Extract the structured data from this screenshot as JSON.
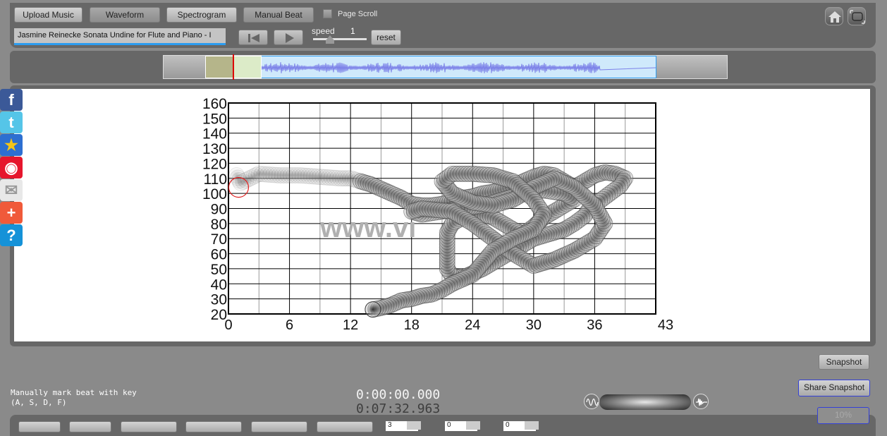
{
  "toolbar": {
    "buttons": [
      "Upload Music",
      "Waveform",
      "Spectrogram",
      "Manual Beat"
    ],
    "page_scroll_label": "Page Scroll",
    "page_scroll_checked": false,
    "track_title": "Jasmine Reinecke Sonata Undine for Flute and Piano - I",
    "speed_label": "speed",
    "speed_value": "1",
    "speed_fraction": 0.33,
    "reset_label": "reset",
    "rewind_icon": "skip-to-start-icon",
    "play_icon": "play-icon",
    "home_icon": "home-icon",
    "fullscreen_icon": "fullscreen-icon"
  },
  "overview": {
    "visible_window_start_fraction": 0.0,
    "visible_window_end_fraction": 1.0,
    "playhead_fraction": 0.0,
    "waveform_color": "#7b80e8",
    "window_color": "#cfe9fb"
  },
  "social": [
    {
      "name": "facebook-icon",
      "color": "#3b5998"
    },
    {
      "name": "twitter-icon",
      "color": "#55c5e8"
    },
    {
      "name": "qzone-icon",
      "color": "#2d6fd1"
    },
    {
      "name": "weibo-icon",
      "color": "#e6162d"
    },
    {
      "name": "email-icon",
      "color": "#e8e8e8"
    },
    {
      "name": "share-plus-icon",
      "color": "#f05a3a"
    },
    {
      "name": "help-icon",
      "color": "#1592d8"
    }
  ],
  "chart_data": {
    "type": "scatter",
    "title": "",
    "xlabel": "",
    "ylabel": "",
    "xlim": [
      0,
      42
    ],
    "ylim": [
      20,
      160
    ],
    "x_ticks": [
      "0",
      "6",
      "12",
      "18",
      "24",
      "30",
      "36",
      "43"
    ],
    "y_ticks": [
      "160",
      "150",
      "140",
      "130",
      "120",
      "110",
      "100",
      "90",
      "80",
      "70",
      "60",
      "50",
      "40",
      "30",
      "20"
    ],
    "grid": true,
    "watermark": "www.vi",
    "current_marker": {
      "x": 1.0,
      "y": 104,
      "color": "#e02020"
    },
    "trail": [
      {
        "x": 0.8,
        "y": 112
      },
      {
        "x": 1.2,
        "y": 107
      },
      {
        "x": 3,
        "y": 113
      },
      {
        "x": 5,
        "y": 112
      },
      {
        "x": 7,
        "y": 112
      },
      {
        "x": 9,
        "y": 111
      },
      {
        "x": 11,
        "y": 110
      },
      {
        "x": 12,
        "y": 110
      },
      {
        "x": 13,
        "y": 108
      },
      {
        "x": 14,
        "y": 106
      },
      {
        "x": 15,
        "y": 103
      },
      {
        "x": 16,
        "y": 100
      },
      {
        "x": 17,
        "y": 97
      },
      {
        "x": 18,
        "y": 93
      },
      {
        "x": 19,
        "y": 92
      },
      {
        "x": 20,
        "y": 92
      },
      {
        "x": 21,
        "y": 93
      },
      {
        "x": 22,
        "y": 95
      },
      {
        "x": 23,
        "y": 97
      },
      {
        "x": 24,
        "y": 98
      },
      {
        "x": 25,
        "y": 100
      },
      {
        "x": 26,
        "y": 101
      },
      {
        "x": 27,
        "y": 103
      },
      {
        "x": 28,
        "y": 105
      },
      {
        "x": 29,
        "y": 108
      },
      {
        "x": 30,
        "y": 111
      },
      {
        "x": 31,
        "y": 113
      },
      {
        "x": 32,
        "y": 112
      },
      {
        "x": 33,
        "y": 108
      },
      {
        "x": 34,
        "y": 104
      },
      {
        "x": 35,
        "y": 108
      },
      {
        "x": 36,
        "y": 112
      },
      {
        "x": 37,
        "y": 114
      },
      {
        "x": 38,
        "y": 113
      },
      {
        "x": 39,
        "y": 110
      },
      {
        "x": 38.5,
        "y": 105
      },
      {
        "x": 37.5,
        "y": 100
      },
      {
        "x": 36.5,
        "y": 95
      },
      {
        "x": 35.5,
        "y": 90
      },
      {
        "x": 35,
        "y": 85
      },
      {
        "x": 34,
        "y": 80
      },
      {
        "x": 33,
        "y": 76
      },
      {
        "x": 32,
        "y": 74
      },
      {
        "x": 31,
        "y": 72
      },
      {
        "x": 30,
        "y": 70
      },
      {
        "x": 29,
        "y": 66
      },
      {
        "x": 28,
        "y": 62
      },
      {
        "x": 27,
        "y": 58
      },
      {
        "x": 26,
        "y": 54
      },
      {
        "x": 25,
        "y": 50
      },
      {
        "x": 24,
        "y": 47
      },
      {
        "x": 23,
        "y": 44
      },
      {
        "x": 22,
        "y": 45
      },
      {
        "x": 21.5,
        "y": 50
      },
      {
        "x": 21.5,
        "y": 56
      },
      {
        "x": 21.5,
        "y": 62
      },
      {
        "x": 21.5,
        "y": 68
      },
      {
        "x": 21.5,
        "y": 74
      },
      {
        "x": 22,
        "y": 80
      },
      {
        "x": 23,
        "y": 84
      },
      {
        "x": 24,
        "y": 86
      },
      {
        "x": 25,
        "y": 86
      },
      {
        "x": 26,
        "y": 84
      },
      {
        "x": 27,
        "y": 80
      },
      {
        "x": 28,
        "y": 76
      },
      {
        "x": 29,
        "y": 73
      },
      {
        "x": 30,
        "y": 78
      },
      {
        "x": 31,
        "y": 84
      },
      {
        "x": 32,
        "y": 88
      },
      {
        "x": 33,
        "y": 92
      },
      {
        "x": 34,
        "y": 96
      },
      {
        "x": 33,
        "y": 100
      },
      {
        "x": 31,
        "y": 102
      },
      {
        "x": 29,
        "y": 100
      },
      {
        "x": 27,
        "y": 96
      },
      {
        "x": 25,
        "y": 92
      },
      {
        "x": 23,
        "y": 90
      },
      {
        "x": 21,
        "y": 88
      },
      {
        "x": 19,
        "y": 86
      },
      {
        "x": 18,
        "y": 88
      },
      {
        "x": 19,
        "y": 90
      },
      {
        "x": 22,
        "y": 88
      },
      {
        "x": 24,
        "y": 80
      },
      {
        "x": 26,
        "y": 70
      },
      {
        "x": 28,
        "y": 60
      },
      {
        "x": 30,
        "y": 52
      },
      {
        "x": 32,
        "y": 56
      },
      {
        "x": 34,
        "y": 62
      },
      {
        "x": 36,
        "y": 70
      },
      {
        "x": 37,
        "y": 80
      },
      {
        "x": 36,
        "y": 92
      },
      {
        "x": 34,
        "y": 104
      },
      {
        "x": 32,
        "y": 110
      },
      {
        "x": 30,
        "y": 104
      },
      {
        "x": 28,
        "y": 96
      },
      {
        "x": 26,
        "y": 92
      },
      {
        "x": 24,
        "y": 94
      },
      {
        "x": 22,
        "y": 100
      },
      {
        "x": 21,
        "y": 108
      },
      {
        "x": 22,
        "y": 113
      },
      {
        "x": 24,
        "y": 113
      },
      {
        "x": 26,
        "y": 112
      },
      {
        "x": 28,
        "y": 108
      },
      {
        "x": 30,
        "y": 96
      },
      {
        "x": 31,
        "y": 86
      },
      {
        "x": 30,
        "y": 76
      },
      {
        "x": 28,
        "y": 70
      },
      {
        "x": 26,
        "y": 62
      },
      {
        "x": 25,
        "y": 54
      },
      {
        "x": 24,
        "y": 46
      },
      {
        "x": 22,
        "y": 40
      },
      {
        "x": 21,
        "y": 36
      },
      {
        "x": 20,
        "y": 33
      },
      {
        "x": 19,
        "y": 32
      },
      {
        "x": 18,
        "y": 30
      },
      {
        "x": 17,
        "y": 29
      },
      {
        "x": 16,
        "y": 26
      },
      {
        "x": 15,
        "y": 24
      },
      {
        "x": 14.2,
        "y": 23
      }
    ]
  },
  "bottom": {
    "beat_hint": "Manually mark beat with key\n(A, S, D, F)",
    "time_current": "0:00:00.000",
    "time_total": "0:07:32.963",
    "mode_left_icon": "sine-wave-icon",
    "mode_right_icon": "waveform-icon",
    "snapshot_label": "Snapshot",
    "share_snapshot_label": "Share Snapshot",
    "ghost_label": "10%",
    "spin_values": [
      "3",
      "0",
      "0"
    ]
  }
}
